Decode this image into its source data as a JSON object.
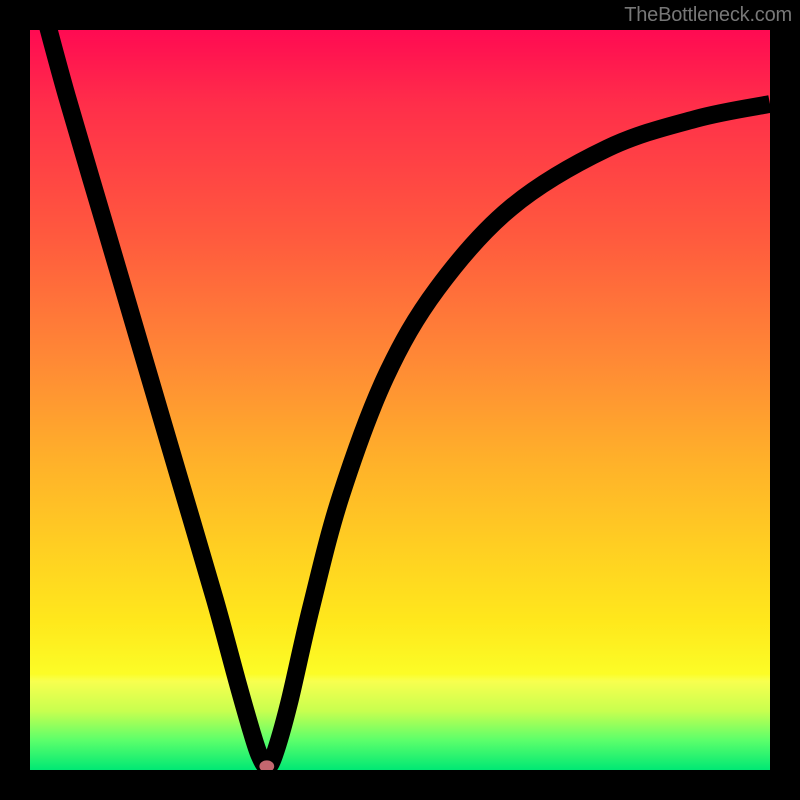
{
  "watermark": "TheBottleneck.com",
  "chart_data": {
    "type": "line",
    "title": "",
    "xlabel": "",
    "ylabel": "",
    "xlim": [
      0,
      100
    ],
    "ylim": [
      0,
      100
    ],
    "series": [
      {
        "name": "bottleneck-curve",
        "x": [
          2,
          5,
          10,
          15,
          20,
          25,
          28,
          30,
          31,
          32,
          33,
          35,
          38,
          42,
          48,
          55,
          65,
          78,
          90,
          100
        ],
        "values": [
          102,
          91,
          74,
          57,
          40,
          23,
          12,
          5,
          2,
          0.5,
          2,
          9,
          22,
          37,
          53,
          65,
          76,
          84,
          88,
          90
        ]
      }
    ],
    "markers": [
      {
        "name": "min-point",
        "x": 32,
        "y": 0.5
      }
    ],
    "background_gradient": {
      "stops": [
        {
          "pos": 0.0,
          "color": "#ff0a52"
        },
        {
          "pos": 0.45,
          "color": "#ff8a35"
        },
        {
          "pos": 0.8,
          "color": "#ffe81c"
        },
        {
          "pos": 0.9,
          "color": "#f8ff4f"
        },
        {
          "pos": 1.0,
          "color": "#00e874"
        }
      ]
    }
  }
}
